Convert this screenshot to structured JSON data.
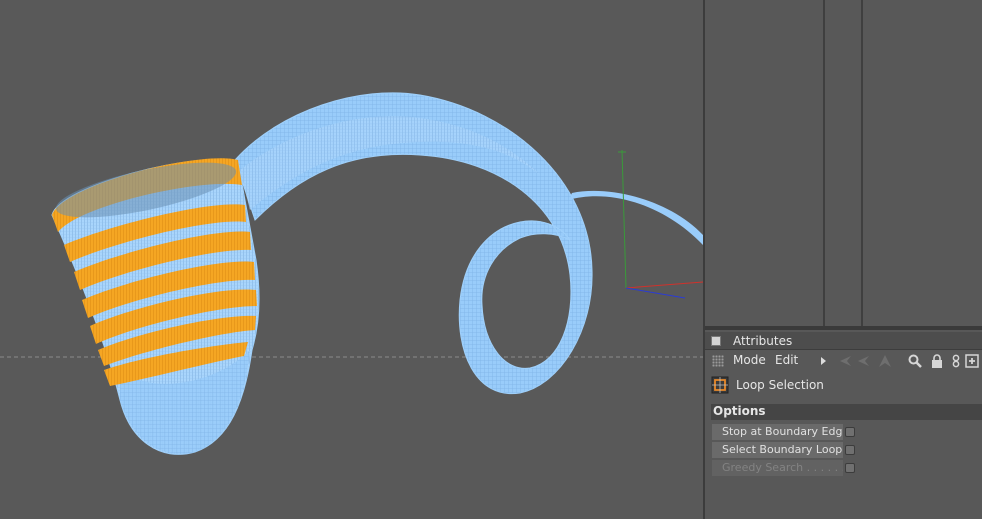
{
  "attributes_panel": {
    "title": "Attributes",
    "menu": {
      "mode": "Mode",
      "edit": "Edit"
    },
    "tool_name": "Loop Selection",
    "section": "Options",
    "options": [
      {
        "label": "Stop at Boundary Edges",
        "checked": false,
        "enabled": true
      },
      {
        "label": "Select Boundary Loop",
        "checked": false,
        "enabled": true
      },
      {
        "label": "Greedy Search . . . . . .",
        "checked": false,
        "enabled": false
      }
    ],
    "toolbar_icons": [
      "arrow-left-icon",
      "arrow-up-icon",
      "search-icon",
      "lock-icon",
      "link-icon",
      "new-panel-icon"
    ]
  },
  "colors": {
    "viewport_bg": "#595959",
    "mesh": "#99ccfa",
    "selection": "#f5a623",
    "axis_x": "#d0322c",
    "axis_y": "#3a9a3a",
    "axis_z": "#2a3bd6"
  }
}
